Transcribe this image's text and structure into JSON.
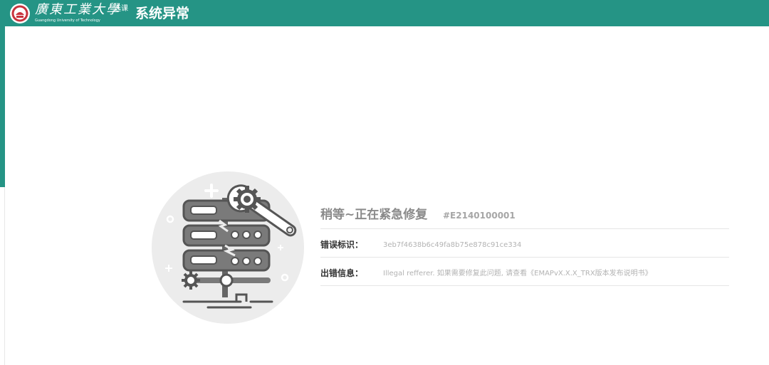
{
  "header": {
    "university_name_cn": "廣東工業大學",
    "university_name_en": "Guangdong University of Technology",
    "app_name": "选课",
    "page_title": "系统异常",
    "accent_color": "#259485"
  },
  "error": {
    "title": "稍等~正在紧急修复",
    "code": "#E2140100001",
    "id_label": "错误标识：",
    "id_value": "3eb7f4638b6c49fa8b75e878c91ce334",
    "info_label": "出错信息：",
    "info_value": "Illegal refferer. 如果需要修复此问题, 请查看《EMAPvX.X.X_TRX版本发布说明书》",
    "illustration": "server-repair-icon"
  }
}
